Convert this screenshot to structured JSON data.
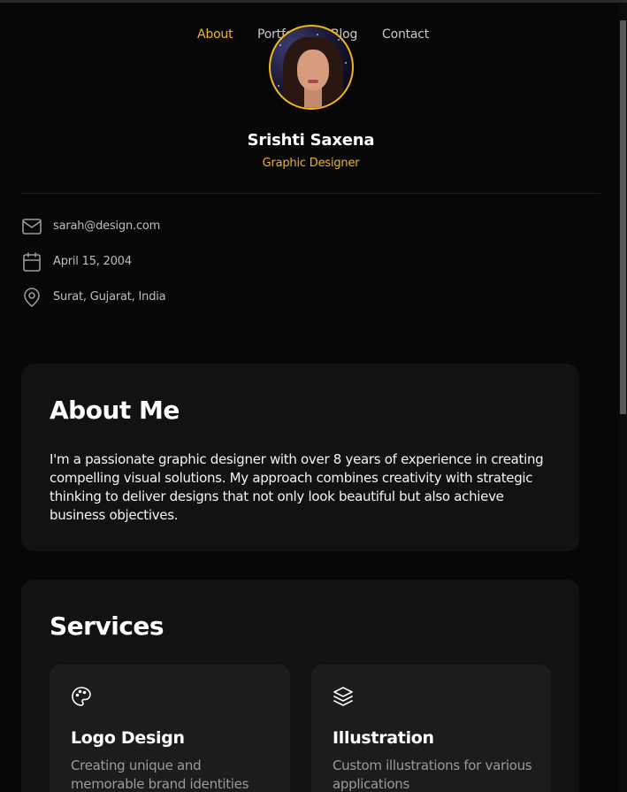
{
  "nav": {
    "items": [
      {
        "label": "About",
        "active": true
      },
      {
        "label": "Portfolio",
        "active": false
      },
      {
        "label": "Blog",
        "active": false
      },
      {
        "label": "Contact",
        "active": false
      }
    ]
  },
  "profile": {
    "name": "Srishti Saxena",
    "role": "Graphic Designer"
  },
  "contact": {
    "email": {
      "icon": "mail-icon",
      "value": "sarah@design.com"
    },
    "birthday": {
      "icon": "calendar-icon",
      "value": "April 15, 2004"
    },
    "location": {
      "icon": "map-pin-icon",
      "value": "Surat, Gujarat, India"
    }
  },
  "about": {
    "title": "About Me",
    "text": "I'm a passionate graphic designer with over 8 years of experience in creating compelling visual solutions. My approach combines creativity with strategic thinking to deliver designs that not only look beautiful but also achieve business objectives."
  },
  "services": {
    "title": "Services",
    "items": [
      {
        "icon": "palette-icon",
        "title": "Logo Design",
        "description": "Creating unique and memorable brand identities"
      },
      {
        "icon": "layers-icon",
        "title": "Illustration",
        "description": "Custom illustrations for various applications"
      }
    ]
  },
  "colors": {
    "accent": "#f2b51c",
    "background": "#070707",
    "card": "#121212",
    "service_card": "#1c1c1c"
  }
}
